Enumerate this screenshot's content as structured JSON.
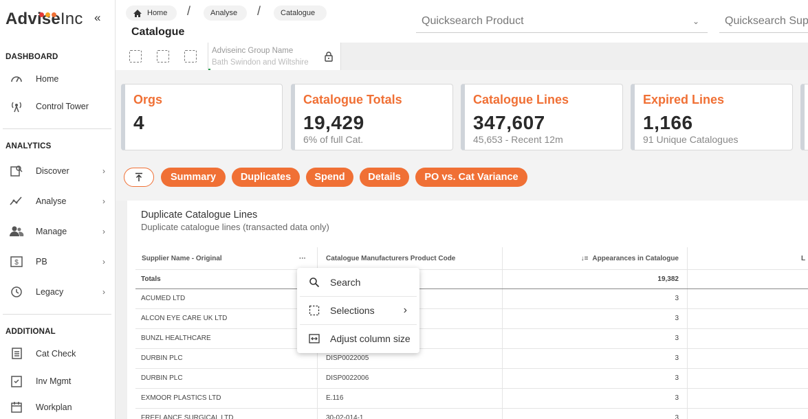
{
  "app": {
    "logo_text": "Advise",
    "logo_suffix": "Inc",
    "collapse_icon": "double-chevron-left-icon",
    "logo_dot_colors": [
      "#e53935",
      "#f5a623",
      "#f07035"
    ]
  },
  "sidebar": {
    "sections": [
      {
        "title": "DASHBOARD"
      },
      {
        "title": "ANALYTICS"
      },
      {
        "title": "ADDITIONAL"
      }
    ],
    "items": [
      {
        "label": "Home",
        "icon": "gauge-icon"
      },
      {
        "label": "Control Tower",
        "icon": "antenna-icon"
      },
      {
        "label": "Discover",
        "icon": "discover-icon",
        "chevron": "›"
      },
      {
        "label": "Analyse",
        "icon": "trend-icon",
        "chevron": "›"
      },
      {
        "label": "Manage",
        "icon": "users-icon",
        "chevron": "›"
      },
      {
        "label": "PB",
        "icon": "currency-icon",
        "chevron": "›"
      },
      {
        "label": "Legacy",
        "icon": "history-icon",
        "chevron": "›"
      },
      {
        "label": "Cat Check",
        "icon": "checklist-icon"
      },
      {
        "label": "Inv Mgmt",
        "icon": "clipboard-check-icon"
      },
      {
        "label": "Workplan",
        "icon": "calendar-icon"
      }
    ]
  },
  "header": {
    "breadcrumbs": [
      "Home",
      "Analyse",
      "Catalogue"
    ],
    "separator": "/",
    "title": "Catalogue",
    "quicksearch_product": "Quicksearch Product",
    "quicksearch_supplier": "Quicksearch Supplier",
    "dropdown_glyph": "⌄",
    "group_name_label": "Adviseinc Group Name",
    "group_name_value": "Bath Swindon and Wiltshire"
  },
  "kpis": [
    {
      "title": "Orgs",
      "value": "4",
      "sub": ""
    },
    {
      "title": "Catalogue Totals",
      "value": "19,429",
      "sub": "6% of full Cat."
    },
    {
      "title": "Catalogue Lines",
      "value": "347,607",
      "sub": "45,653 - Recent 12m"
    },
    {
      "title": "Expired Lines",
      "value": "1,166",
      "sub": "91 Unique Catalogues"
    }
  ],
  "tabs": [
    "Summary",
    "Duplicates",
    "Spend",
    "Details",
    "PO vs. Cat Variance"
  ],
  "accent_color": "#f07035",
  "table": {
    "title": "Duplicate Catalogue Lines",
    "subtitle": "Duplicate catalogue lines (transacted data only)",
    "columns": [
      "Supplier Name - Original",
      "Catalogue Manufacturers Product Code",
      "Appearances in Catalogue",
      "L"
    ],
    "sort_glyph": "↓≡",
    "more_glyph": "···",
    "totals_label": "Totals",
    "totals_value": "19,382",
    "rows": [
      {
        "supplier": "ACUMED LTD",
        "code": "",
        "count": "3"
      },
      {
        "supplier": "ALCON EYE CARE UK LTD",
        "code": "",
        "count": "3"
      },
      {
        "supplier": "BUNZL HEALTHCARE",
        "code": "",
        "count": "3"
      },
      {
        "supplier": "DURBIN PLC",
        "code": "DISP0022005",
        "count": "3"
      },
      {
        "supplier": "DURBIN PLC",
        "code": "DISP0022006",
        "count": "3"
      },
      {
        "supplier": "EXMOOR PLASTICS LTD",
        "code": "E.116",
        "count": "3"
      },
      {
        "supplier": "FREELANCE SURGICAL LTD",
        "code": "30-02-014-1",
        "count": "3"
      }
    ]
  },
  "context_menu": {
    "items": [
      "Search",
      "Selections",
      "Adjust column size"
    ],
    "submenu_glyph": "›"
  }
}
